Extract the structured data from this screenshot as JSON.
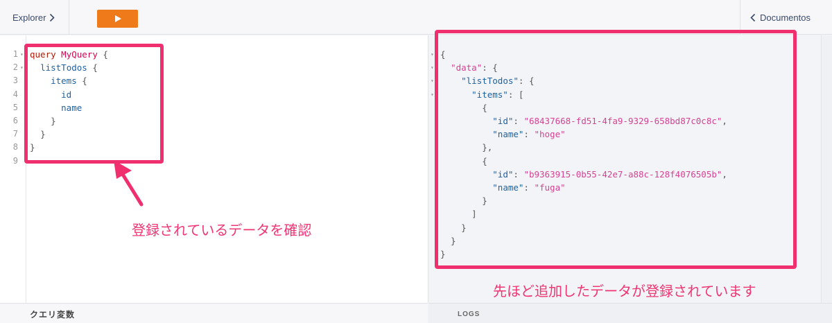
{
  "toolbar": {
    "explorer_label": "Explorer",
    "docs_label": "Documentos",
    "run_color": "#ee7a1a",
    "icons": [
      "chevron-right-icon",
      "play-icon",
      "chevron-left-icon"
    ]
  },
  "editor": {
    "lines": [
      {
        "n": "1",
        "fold": "▾",
        "tokens": [
          {
            "t": "query",
            "c": "kw"
          },
          {
            "t": " "
          },
          {
            "t": "MyQuery",
            "c": "fn"
          },
          {
            "t": " {",
            "c": "pn"
          }
        ]
      },
      {
        "n": "2",
        "fold": "▾",
        "tokens": [
          {
            "t": "  "
          },
          {
            "t": "listTodos",
            "c": "fld"
          },
          {
            "t": " {",
            "c": "pn"
          }
        ]
      },
      {
        "n": "3",
        "fold": "",
        "tokens": [
          {
            "t": "    "
          },
          {
            "t": "items",
            "c": "fld"
          },
          {
            "t": " {",
            "c": "pn"
          }
        ]
      },
      {
        "n": "4",
        "fold": "",
        "tokens": [
          {
            "t": "      "
          },
          {
            "t": "id",
            "c": "fld"
          }
        ]
      },
      {
        "n": "5",
        "fold": "",
        "tokens": [
          {
            "t": "      "
          },
          {
            "t": "name",
            "c": "fld"
          }
        ]
      },
      {
        "n": "6",
        "fold": "",
        "tokens": [
          {
            "t": "    "
          },
          {
            "t": "}",
            "c": "pn"
          }
        ]
      },
      {
        "n": "7",
        "fold": "",
        "tokens": [
          {
            "t": "  "
          },
          {
            "t": "}",
            "c": "pn"
          }
        ]
      },
      {
        "n": "8",
        "fold": "",
        "tokens": [
          {
            "t": "}",
            "c": "pn"
          }
        ]
      },
      {
        "n": "9",
        "fold": "",
        "tokens": []
      }
    ]
  },
  "result": {
    "lines": [
      {
        "fold": "▾",
        "tokens": [
          {
            "t": "{"
          }
        ]
      },
      {
        "fold": "▾",
        "tokens": [
          {
            "t": "  "
          },
          {
            "t": "\"data\"",
            "c": "str"
          },
          {
            "t": ": {"
          }
        ]
      },
      {
        "fold": "▾",
        "tokens": [
          {
            "t": "    "
          },
          {
            "t": "\"listTodos\"",
            "c": "key"
          },
          {
            "t": ": {"
          }
        ]
      },
      {
        "fold": "▾",
        "tokens": [
          {
            "t": "      "
          },
          {
            "t": "\"items\"",
            "c": "key"
          },
          {
            "t": ": ["
          }
        ]
      },
      {
        "fold": "",
        "tokens": [
          {
            "t": "        {"
          }
        ]
      },
      {
        "fold": "",
        "tokens": [
          {
            "t": "          "
          },
          {
            "t": "\"id\"",
            "c": "key"
          },
          {
            "t": ": "
          },
          {
            "t": "\"68437668-fd51-4fa9-9329-658bd87c0c8c\"",
            "c": "str"
          },
          {
            "t": ","
          }
        ]
      },
      {
        "fold": "",
        "tokens": [
          {
            "t": "          "
          },
          {
            "t": "\"name\"",
            "c": "key"
          },
          {
            "t": ": "
          },
          {
            "t": "\"hoge\"",
            "c": "str"
          }
        ]
      },
      {
        "fold": "",
        "tokens": [
          {
            "t": "        },"
          }
        ]
      },
      {
        "fold": "",
        "tokens": [
          {
            "t": "        {"
          }
        ]
      },
      {
        "fold": "",
        "tokens": [
          {
            "t": "          "
          },
          {
            "t": "\"id\"",
            "c": "key"
          },
          {
            "t": ": "
          },
          {
            "t": "\"b9363915-0b55-42e7-a88c-128f4076505b\"",
            "c": "str"
          },
          {
            "t": ","
          }
        ]
      },
      {
        "fold": "",
        "tokens": [
          {
            "t": "          "
          },
          {
            "t": "\"name\"",
            "c": "key"
          },
          {
            "t": ": "
          },
          {
            "t": "\"fuga\"",
            "c": "str"
          }
        ]
      },
      {
        "fold": "",
        "tokens": [
          {
            "t": "        }"
          }
        ]
      },
      {
        "fold": "",
        "tokens": [
          {
            "t": "      ]"
          }
        ]
      },
      {
        "fold": "",
        "tokens": [
          {
            "t": "    }"
          }
        ]
      },
      {
        "fold": "",
        "tokens": [
          {
            "t": "  }"
          }
        ]
      },
      {
        "fold": "",
        "tokens": [
          {
            "t": "}"
          }
        ]
      }
    ]
  },
  "panels": {
    "variables_title": "クエリ変数",
    "logs_title": "LOGS"
  },
  "annotations": {
    "left_note": "登録されているデータを確認",
    "right_note": "先ほど追加したデータが登録されています",
    "highlight_color": "#f0306e"
  }
}
